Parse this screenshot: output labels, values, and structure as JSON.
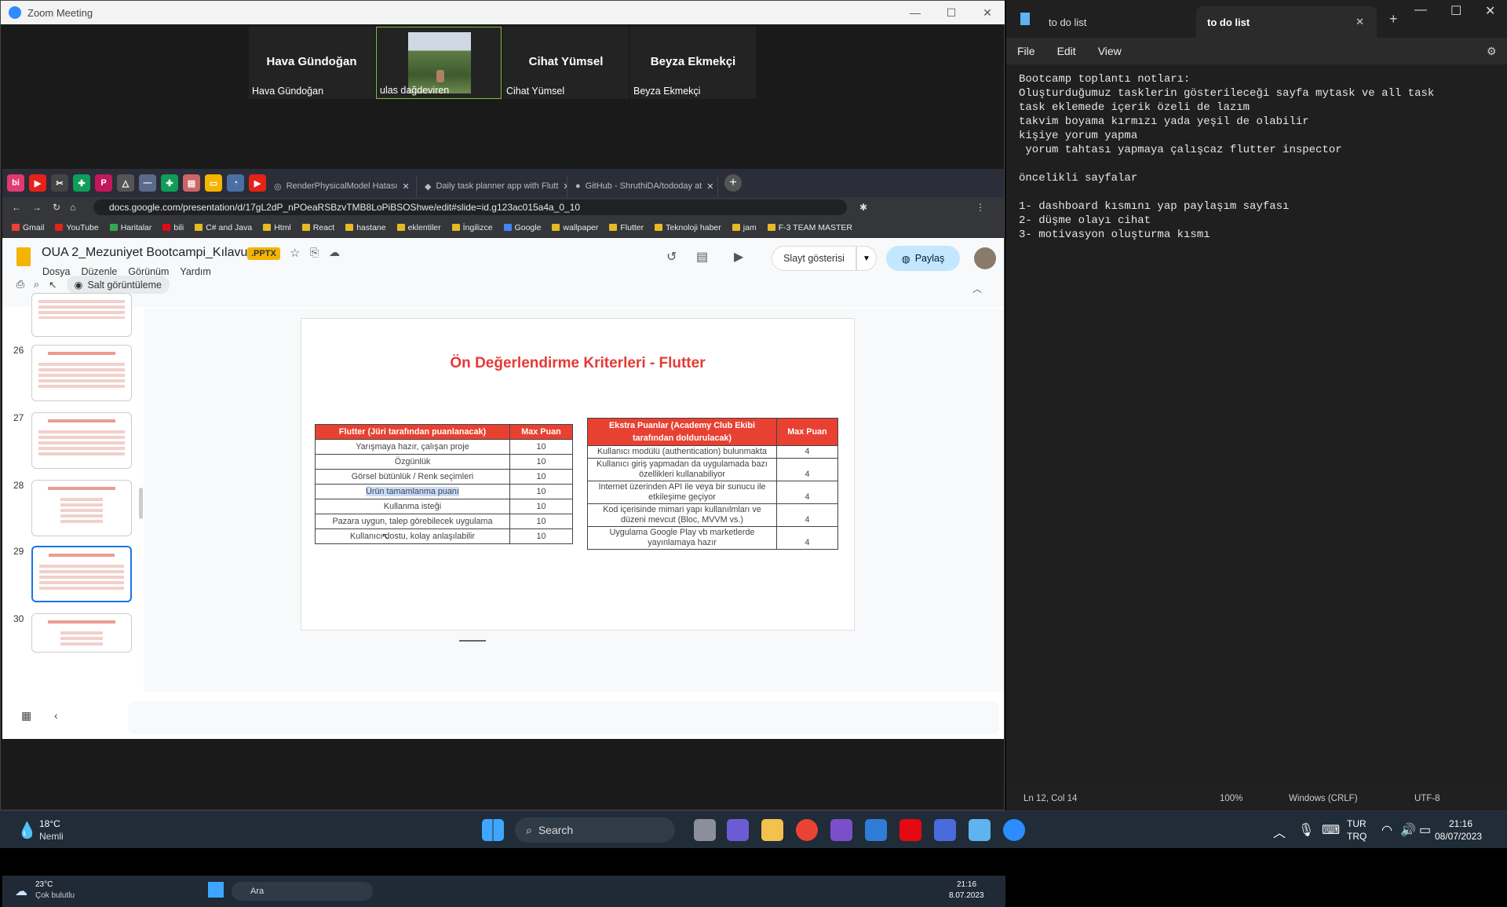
{
  "zoom": {
    "title": "Zoom Meeting",
    "participants": [
      {
        "big": "Hava Gündoğan",
        "name": "Hava Gündoğan"
      },
      {
        "big": "",
        "name": "ulas dağdeviren"
      },
      {
        "big": "Cihat Yümsel",
        "name": "Cihat Yümsel"
      },
      {
        "big": "Beyza Ekmekçi",
        "name": "Beyza Ekmekçi"
      }
    ]
  },
  "browser": {
    "tabs": [
      "RenderPhysicalModel Hatası",
      "Daily task planner app with Flutt",
      "GitHub - ShruthiDA/tododay at"
    ],
    "url": "docs.google.com/presentation/d/17gL2dP_nPOeaRSBzvTMB8LoPiBSOShwe/edit#slide=id.g123ac015a4a_0_10",
    "bookmarks": [
      "Gmail",
      "YouTube",
      "Haritalar",
      "bili",
      "C# and Java",
      "Html",
      "React",
      "hastane",
      "eklentiler",
      "İngilizce",
      "Google",
      "wallpaper",
      "Flutter",
      "Teknoloji haber",
      "jam",
      "F-3 TEAM MASTER"
    ]
  },
  "slides": {
    "doc_title": "OUA 2_Mezuniyet Bootcampi_Kılavuz",
    "badge": ".PPTX",
    "menus": [
      "Dosya",
      "Düzenle",
      "Görünüm",
      "Yardım"
    ],
    "present": "Slayt gösterisi",
    "share": "Paylaş",
    "view_only": "Salt görüntüleme",
    "thumb_numbers": [
      "26",
      "27",
      "28",
      "29",
      "30"
    ],
    "slide_title": "Ön Değerlendirme Kriterleri - Flutter",
    "table1": {
      "headers": [
        "Flutter (Jüri tarafından puanlanacak)",
        "Max Puan"
      ],
      "rows": [
        [
          "Yarışmaya hazır, çalışan proje",
          "10"
        ],
        [
          "Özgünlük",
          "10"
        ],
        [
          "Görsel bütünlük / Renk seçimleri",
          "10"
        ],
        [
          "Ürün tamamlanma puanı",
          "10"
        ],
        [
          "Kullanma isteği",
          "10"
        ],
        [
          "Pazara uygun, talep görebilecek uygulama",
          "10"
        ],
        [
          "Kullanıcı dostu, kolay anlaşılabilir",
          "10"
        ]
      ]
    },
    "table2": {
      "headers": [
        "Ekstra Puanlar (Academy Club Ekibi tarafından doldurulacak)",
        "Max Puan"
      ],
      "rows": [
        [
          "Kullanıcı modülü (authentication) bulunmakta",
          "4"
        ],
        [
          "Kullanıcı giriş yapmadan da uygulamada bazı özellikleri kullanabiliyor",
          "4"
        ],
        [
          "Internet üzerinden API ile veya bir sunucu ile etkileşime geçiyor",
          "4"
        ],
        [
          "Kod içerisinde mimari yapı kullanılmları ve düzeni mevcut (Bloc, MVVM vs.)",
          "4"
        ],
        [
          "Uygulama Google Play vb marketlerde yayınlamaya hazır",
          "4"
        ]
      ]
    }
  },
  "shared_taskbar": {
    "weather_temp": "23°C",
    "weather_desc": "Çok bulutlu",
    "search": "Ara",
    "time": "21:16",
    "date": "8.07.2023"
  },
  "notepad": {
    "tab1": "to do list",
    "tab2": "to do list",
    "menu": [
      "File",
      "Edit",
      "View"
    ],
    "content": "Bootcamp toplantı notları:\nOluşturduğumuz tasklerin gösterileceği sayfa mytask ve all task\ntask eklemede içerik özeli de lazım\ntakvim boyama kırmızı yada yeşil de olabilir\nkişiye yorum yapma\n yorum tahtası yapmaya çalışcaz flutter inspector\n\nöncelikli sayfalar\n\n1- dashboard kısmını yap paylaşım sayfası\n2- düşme olayı cihat\n3- motivasyon oluşturma kısmı",
    "status": {
      "position": "Ln 12, Col 14",
      "zoom": "100%",
      "eol": "Windows (CRLF)",
      "encoding": "UTF-8"
    }
  },
  "taskbar": {
    "weather_temp": "18°C",
    "weather_desc": "Nemli",
    "search": "Search",
    "lang1": "TUR",
    "lang2": "TRQ",
    "time": "21:16",
    "date": "08/07/2023"
  }
}
